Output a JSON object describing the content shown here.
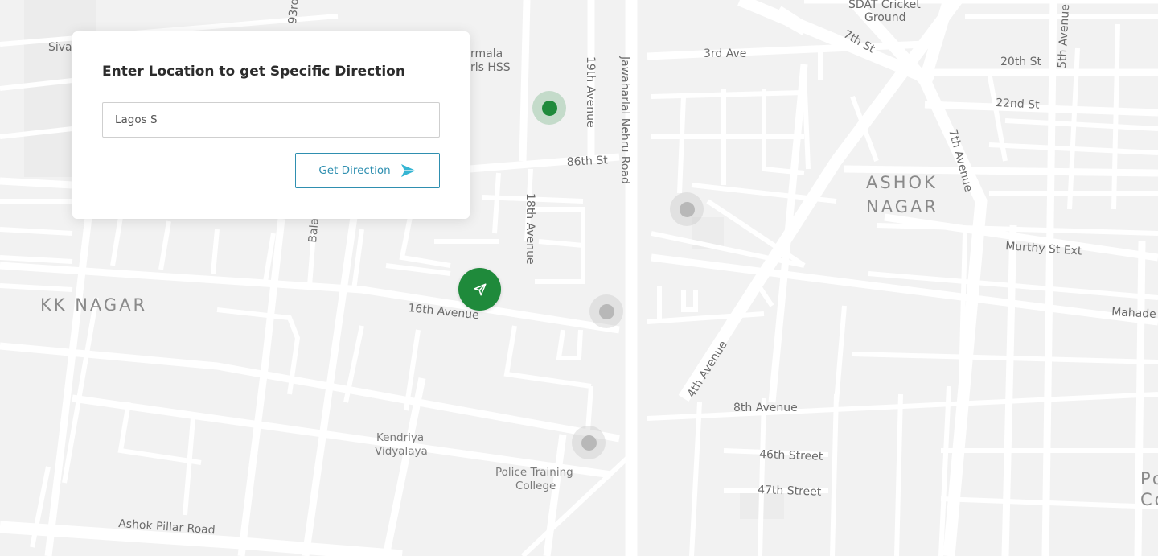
{
  "panel": {
    "title": "Enter Location to get Specific Direction",
    "input_value": "Lagos S",
    "button_label": "Get Direction"
  },
  "map": {
    "labels": {
      "sdat_line1": "SDAT Cricket",
      "sdat_line2": "Ground",
      "third_ave": "3rd Ave",
      "seventh_st": "7th St",
      "twentieth_st": "20th St",
      "twentysecond_st": "22nd St",
      "fifth_ave": "5th Avenue",
      "seventh_ave": "7th Avenue",
      "nineteenth_ave": "19th Avenue",
      "jawaharlal": "Jawaharlal Nehru Road",
      "eightysixth_st": "86th St",
      "eighteenth_ave": "18th Avenue",
      "ninetythird": "93rd",
      "nirmala_line1": "rmala",
      "nirmala_line2": "rls HSS",
      "siva": "Siva",
      "bala": "Bala",
      "ashok_line1": "ASHOK",
      "ashok_line2": "NAGAR",
      "murthy": "Murthy St Ext",
      "mahade": "Mahade",
      "kk_nagar": "KK NAGAR",
      "sixteenth_ave": "16th Avenue",
      "fourth_ave": "4th Avenue",
      "eighth_ave": "8th Avenue",
      "fortysixth": "46th Street",
      "fortyseventh": "47th Street",
      "kendriya_line1": "Kendriya",
      "kendriya_line2": "Vidyalaya",
      "police_line1": "Police Training",
      "police_line2": "College",
      "ashok_pillar": "Ashok Pillar Road",
      "po_line1": "Po",
      "po_line2": "Co"
    }
  },
  "colors": {
    "accent_green": "#1f8a3b",
    "button_blue": "#2f8fb0",
    "arrow_cyan": "#35b5d3",
    "marker_gray": "#b8b8b8"
  },
  "icons": {
    "locate": "navigation-arrow-icon",
    "send": "paper-plane-icon"
  }
}
